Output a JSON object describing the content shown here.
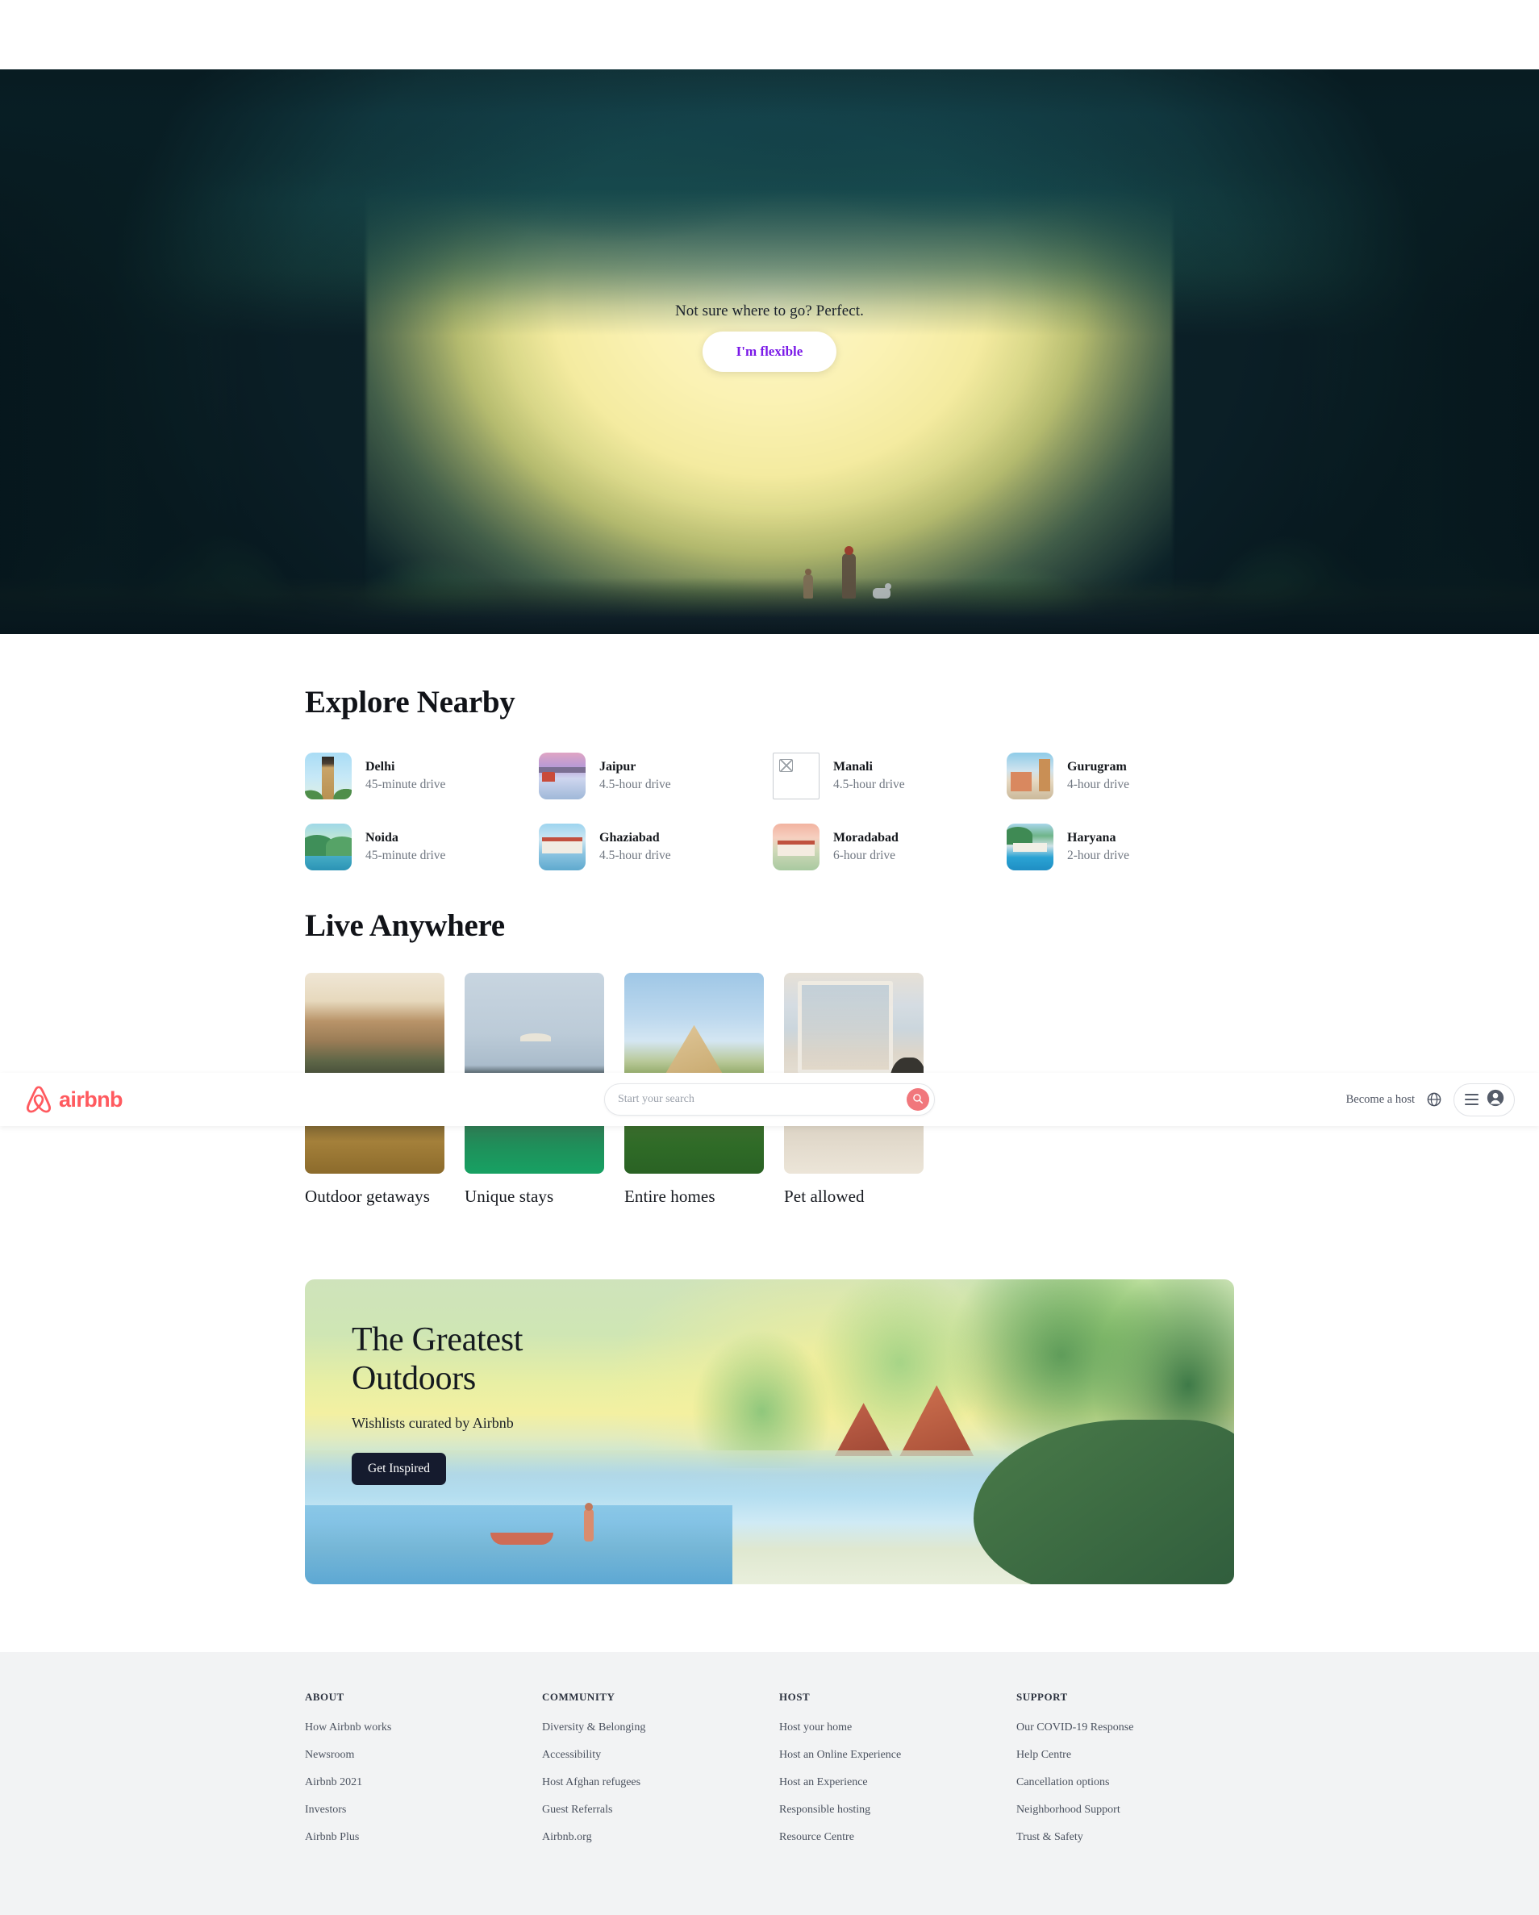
{
  "hero": {
    "tagline": "Not sure where to go? Perfect.",
    "button_label": "I'm flexible",
    "button_text_color": "#7a19e8"
  },
  "navbar": {
    "logo_text": "airbnb",
    "logo_color": "#ff5a5f",
    "search_placeholder": "Start your search",
    "search_value": "",
    "search_icon": "magnifier-icon",
    "search_button_color": "#f1777c",
    "become_host_label": "Become a host",
    "globe_icon": "globe-icon",
    "hamburger_icon": "hamburger-icon",
    "avatar_icon": "user-avatar-icon"
  },
  "explore": {
    "title": "Explore Nearby",
    "cities": [
      {
        "name": "Delhi",
        "distance": "45-minute drive",
        "art": "art-delhi",
        "broken": false
      },
      {
        "name": "Jaipur",
        "distance": "4.5-hour drive",
        "art": "art-jaipur",
        "broken": false
      },
      {
        "name": "Manali",
        "distance": "4.5-hour drive",
        "art": "",
        "broken": true
      },
      {
        "name": "Gurugram",
        "distance": "4-hour drive",
        "art": "art-gurugram",
        "broken": false
      },
      {
        "name": "Noida",
        "distance": "45-minute drive",
        "art": "art-noida",
        "broken": false
      },
      {
        "name": "Ghaziabad",
        "distance": "4.5-hour drive",
        "art": "art-ghaziabad",
        "broken": false
      },
      {
        "name": "Moradabad",
        "distance": "6-hour drive",
        "art": "art-moradabad",
        "broken": false
      },
      {
        "name": "Haryana",
        "distance": "2-hour drive",
        "art": "art-haryana",
        "broken": false
      }
    ]
  },
  "live_anywhere": {
    "title": "Live Anywhere",
    "cards": [
      {
        "label": "Outdoor getaways",
        "art": "li-outdoor"
      },
      {
        "label": "Unique stays",
        "art": "li-unique"
      },
      {
        "label": "Entire homes",
        "art": "li-entire"
      },
      {
        "label": "Pet allowed",
        "art": "li-pet"
      }
    ]
  },
  "outdoors_banner": {
    "title": "The Greatest\nOutdoors",
    "subtitle": "Wishlists curated by Airbnb",
    "button_label": "Get Inspired",
    "button_color": "#151b2e"
  },
  "footer": {
    "columns": [
      {
        "heading": "ABOUT",
        "links": [
          "How Airbnb works",
          "Newsroom",
          "Airbnb 2021",
          "Investors",
          "Airbnb Plus"
        ]
      },
      {
        "heading": "COMMUNITY",
        "links": [
          "Diversity & Belonging",
          "Accessibility",
          "Host Afghan refugees",
          "Guest Referrals",
          "Airbnb.org"
        ]
      },
      {
        "heading": "HOST",
        "links": [
          "Host your home",
          "Host an Online Experience",
          "Host an Experience",
          "Responsible hosting",
          "Resource Centre"
        ]
      },
      {
        "heading": "SUPPORT",
        "links": [
          "Our COVID-19 Response",
          "Help Centre",
          "Cancellation options",
          "Neighborhood Support",
          "Trust & Safety"
        ]
      }
    ]
  }
}
